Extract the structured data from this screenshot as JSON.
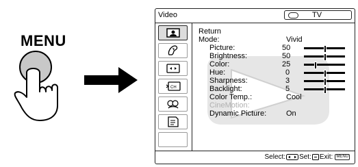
{
  "remote": {
    "menu_label": "MENU"
  },
  "osd": {
    "title": "Video",
    "input": "TV",
    "icons": [
      "picture-icon",
      "sound-icon",
      "screen-icon",
      "channel-setup-icon",
      "parental-lock-icon",
      "setup-icon"
    ],
    "menu": {
      "return_label": "Return",
      "mode_label": "Mode:",
      "mode_value": "Vivid",
      "items": [
        {
          "label": "Picture:",
          "value": "50",
          "level": 0.5
        },
        {
          "label": "Brightness:",
          "value": "50",
          "level": 0.5
        },
        {
          "label": "Color:",
          "value": "25",
          "level": 0.25
        },
        {
          "label": "Hue:",
          "value": "0",
          "level": 0.5
        },
        {
          "label": "Sharpness:",
          "value": "3",
          "level": 0.5
        },
        {
          "label": "Backlight:",
          "value": "5",
          "level": 0.5
        }
      ],
      "color_temp_label": "Color Temp.:",
      "color_temp_value": "Cool",
      "cinemotion_label": "CineMotion:",
      "dynamic_picture_label": "Dynamic Picture:",
      "dynamic_picture_value": "On"
    },
    "footer": {
      "select_label": "Select:",
      "set_label": "Set:",
      "exit_label": "Exit:",
      "exit_key": "MENU"
    }
  }
}
